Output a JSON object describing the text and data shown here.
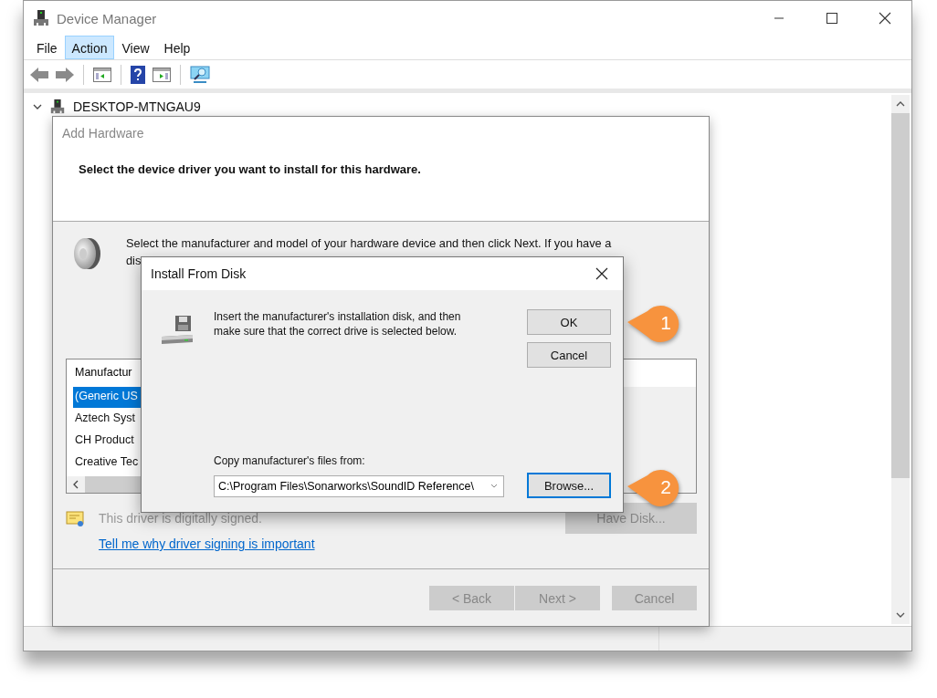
{
  "window": {
    "title": "Device Manager"
  },
  "menu": [
    {
      "label": "File",
      "selected": false
    },
    {
      "label": "Action",
      "selected": true
    },
    {
      "label": "View",
      "selected": false
    },
    {
      "label": "Help",
      "selected": false
    }
  ],
  "tree": {
    "label": "DESKTOP-MTNGAU9",
    "expanded": true
  },
  "add_hardware": {
    "title": "Add Hardware",
    "heading": "Select the device driver you want to install for this hardware.",
    "description_lines": [
      "Select the manufacturer and model of your hardware device and then click Next. If you have a",
      "dis"
    ],
    "manufacturer_list": {
      "header": "Manufactur",
      "items": [
        {
          "label": "(Generic US",
          "selected": true
        },
        {
          "label": "Aztech Syst",
          "selected": false
        },
        {
          "label": "CH Product",
          "selected": false
        },
        {
          "label": "Creative Tec",
          "selected": false
        }
      ]
    },
    "signature": "This driver is digitally signed.",
    "link": "Tell me why driver signing is important",
    "have_disk": {
      "label": "Have Disk...",
      "disabled": true
    },
    "buttons": [
      {
        "label": "< Back",
        "disabled": true
      },
      {
        "label": "Next >",
        "disabled": true
      },
      {
        "label": "Cancel",
        "disabled": true
      }
    ]
  },
  "install_from_disk": {
    "title": "Install From Disk",
    "message": "Insert the manufacturer's installation disk, and then make sure that the correct drive is selected below.",
    "buttons": [
      {
        "label": "OK",
        "focused": false
      },
      {
        "label": "Cancel",
        "focused": false
      }
    ],
    "copy_label": "Copy manufacturer's files from:",
    "path": "C:\\Program Files\\Sonarworks\\SoundID Reference\\",
    "browse": {
      "label": "Browse...",
      "focused": true
    }
  },
  "callouts": [
    "1",
    "2"
  ]
}
